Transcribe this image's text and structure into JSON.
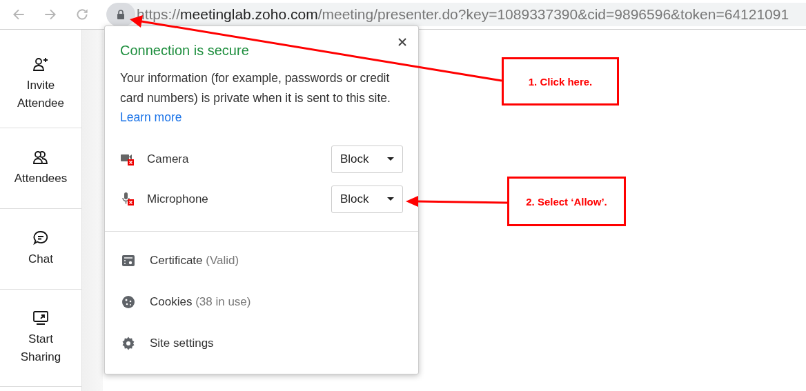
{
  "address_bar": {
    "scheme": "https://",
    "host": "meetinglab.zoho.com",
    "path": "/meeting/presenter.do?key=1089337390&cid=9896596&token=64121091"
  },
  "sidebar": {
    "items": [
      {
        "kind": "invite",
        "label": "Invite Attendee"
      },
      {
        "kind": "attendees",
        "label": "Attendees"
      },
      {
        "kind": "chat",
        "label": "Chat"
      },
      {
        "kind": "share",
        "label": "Start Sharing"
      }
    ]
  },
  "popup": {
    "title": "Connection is secure",
    "message": "Your information (for example, passwords or credit card numbers) is private when it is sent to this site.",
    "link": "Learn more",
    "permissions": [
      {
        "kind": "camera",
        "label": "Camera",
        "value": "Block"
      },
      {
        "kind": "microphone",
        "label": "Microphone",
        "value": "Block"
      }
    ],
    "menu": [
      {
        "kind": "certificate",
        "label": "Certificate",
        "detail": "(Valid)"
      },
      {
        "kind": "cookies",
        "label": "Cookies",
        "detail": "(38 in use)"
      },
      {
        "kind": "settings",
        "label": "Site settings"
      }
    ]
  },
  "annotations": [
    {
      "text": "1. Click here."
    },
    {
      "text": "2. Select ‘Allow’."
    }
  ]
}
